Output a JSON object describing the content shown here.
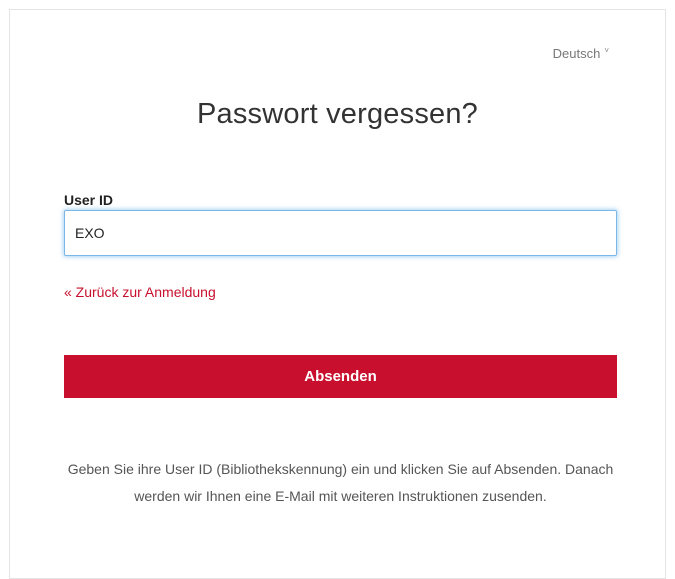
{
  "language": {
    "selected": "Deutsch",
    "chevron": "˅"
  },
  "page": {
    "title": "Passwort vergessen?"
  },
  "form": {
    "user_id_label": "User ID",
    "user_id_value": "EXO",
    "back_link": "« Zurück zur Anmeldung",
    "submit_label": "Absenden",
    "help_text": "Geben Sie ihre User ID (Bibliothekskennung) ein und klicken Sie auf Absenden. Danach werden wir Ihnen eine E-Mail mit weiteren Instruktionen zusenden."
  },
  "colors": {
    "accent": "#c8102e",
    "focus_border": "#7bb8e8"
  }
}
